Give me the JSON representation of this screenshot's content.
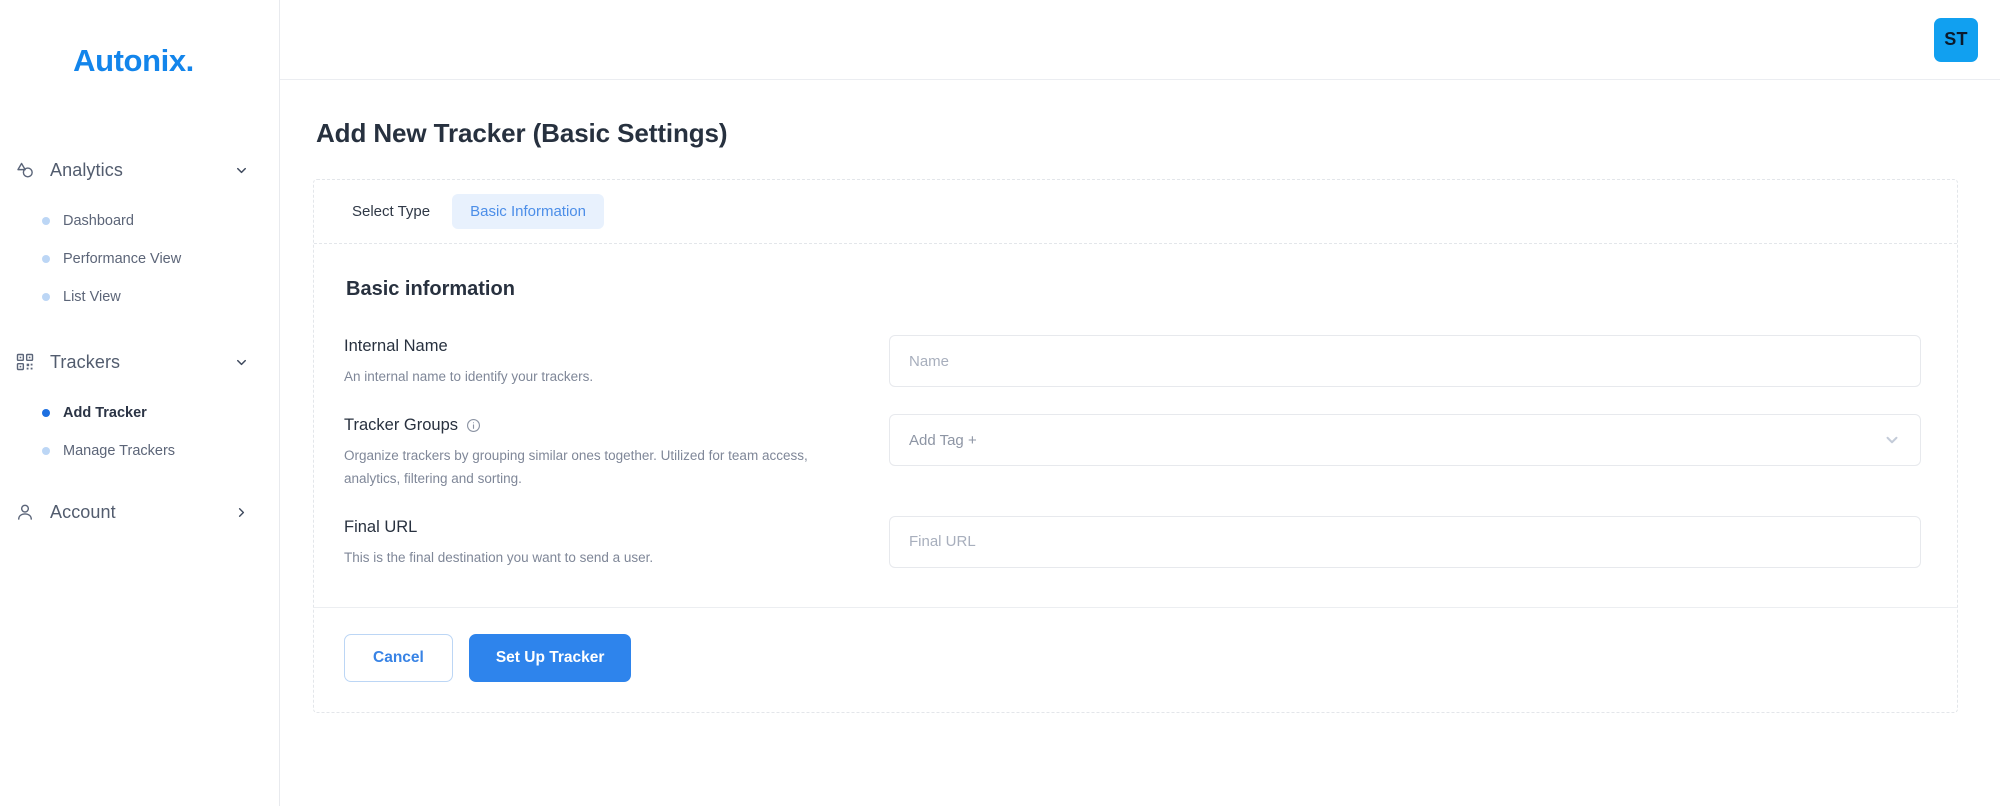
{
  "sidebar": {
    "logo": "Autonix.",
    "groups": [
      {
        "label": "Analytics",
        "icon": "analytics-shapes-icon",
        "chevron": "chevron-down-icon",
        "items": [
          {
            "label": "Dashboard",
            "active": false
          },
          {
            "label": "Performance View",
            "active": false
          },
          {
            "label": "List View",
            "active": false
          }
        ]
      },
      {
        "label": "Trackers",
        "icon": "qr-code-icon",
        "chevron": "chevron-down-icon",
        "items": [
          {
            "label": "Add Tracker",
            "active": true
          },
          {
            "label": "Manage Trackers",
            "active": false
          }
        ]
      },
      {
        "label": "Account",
        "icon": "user-icon",
        "chevron": "chevron-right-icon",
        "items": []
      }
    ]
  },
  "topbar": {
    "avatar_initials": "ST"
  },
  "page": {
    "title": "Add New Tracker (Basic Settings)"
  },
  "tabs": [
    {
      "label": "Select Type",
      "active": false
    },
    {
      "label": "Basic Information",
      "active": true
    }
  ],
  "form": {
    "section_title": "Basic information",
    "fields": [
      {
        "label": "Internal Name",
        "description": "An internal name to identify your trackers.",
        "control": "input",
        "placeholder": "Name",
        "value": "",
        "has_info_icon": false
      },
      {
        "label": "Tracker Groups",
        "description": "Organize trackers by grouping similar ones together. Utilized for team access, analytics, filtering and sorting.",
        "control": "select",
        "placeholder": "Add Tag +",
        "value": "",
        "has_info_icon": true
      },
      {
        "label": "Final URL",
        "description": "This is the final destination you want to send a user.",
        "control": "input",
        "placeholder": "Final URL",
        "value": "",
        "has_info_icon": false
      }
    ]
  },
  "footer": {
    "cancel_label": "Cancel",
    "submit_label": "Set Up Tracker"
  },
  "colors": {
    "brand_blue": "#1385eb",
    "primary_button": "#2e84ec",
    "tab_active_bg": "#e8f1fd",
    "tab_active_text": "#4c8ee8",
    "avatar_bg": "#11a0f0",
    "bullet_active": "#1d6fe0",
    "bullet_inactive": "#bcd6f5"
  }
}
